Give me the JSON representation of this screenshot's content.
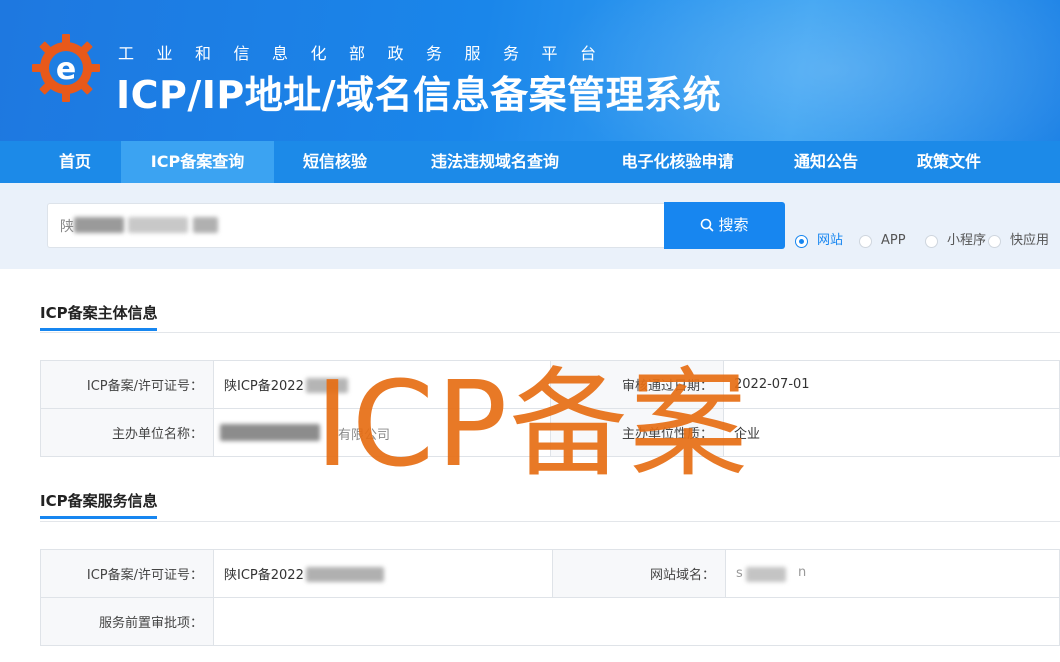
{
  "header": {
    "subtitle": "工业和信息化部政务服务平台",
    "title": "ICP/IP地址/域名信息备案管理系统"
  },
  "nav": {
    "items": [
      "首页",
      "ICP备案查询",
      "短信核验",
      "违法违规域名查询",
      "电子化核验申请",
      "通知公告",
      "政策文件"
    ],
    "active_index": 1
  },
  "search": {
    "value_prefix": "陕",
    "button_label": "搜索",
    "options": [
      "网站",
      "APP",
      "小程序",
      "快应用"
    ],
    "selected_option": "网站"
  },
  "section_subject": {
    "title": "ICP备案主体信息",
    "rows": [
      {
        "label": "ICP备案/许可证号：",
        "value": "陕ICP备2022",
        "label2": "审核通过日期：",
        "value2": "2022-07-01"
      },
      {
        "label": "主办单位名称：",
        "value": "有限公司",
        "label2": "主办单位性质：",
        "value2": "企业"
      }
    ]
  },
  "section_service": {
    "title": "ICP备案服务信息",
    "rows": [
      {
        "label": "ICP备案/许可证号：",
        "value": "陕ICP备2022",
        "label2": "网站域名：",
        "value2_start": "s",
        "value2_end": "n"
      },
      {
        "label": "服务前置审批项：",
        "value": ""
      }
    ]
  },
  "watermark": "ICP备案",
  "colors": {
    "primary": "#1786f0",
    "nav": "#1c8ae8",
    "nav_active": "#3ba3f2",
    "watermark": "#e66e14"
  }
}
